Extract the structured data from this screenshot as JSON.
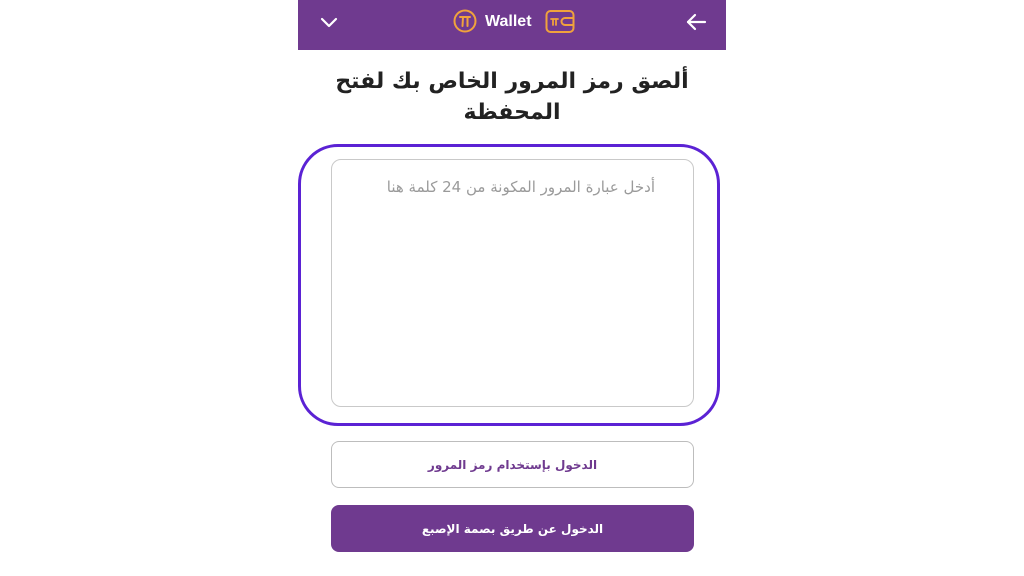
{
  "header": {
    "title": "Wallet",
    "icons": {
      "left": "chevron-down-icon",
      "logo": "pi-logo-icon",
      "wallet": "wallet-icon",
      "right": "arrow-back-icon"
    },
    "colors": {
      "bar": "#6f3a8f",
      "accent": "#f0a23c"
    }
  },
  "main": {
    "heading": "ألصق رمز المرور الخاص بك لفتح المحفظة",
    "passphrase_input": {
      "placeholder": "أدخل عبارة المرور المكونة من 24 كلمة هنا",
      "value": ""
    },
    "buttons": {
      "passphrase_login": "الدخول بإستخدام رمز المرور",
      "fingerprint_login": "الدخول عن طريق بصمة الإصبع"
    },
    "highlight_color": "#5b22d4"
  }
}
